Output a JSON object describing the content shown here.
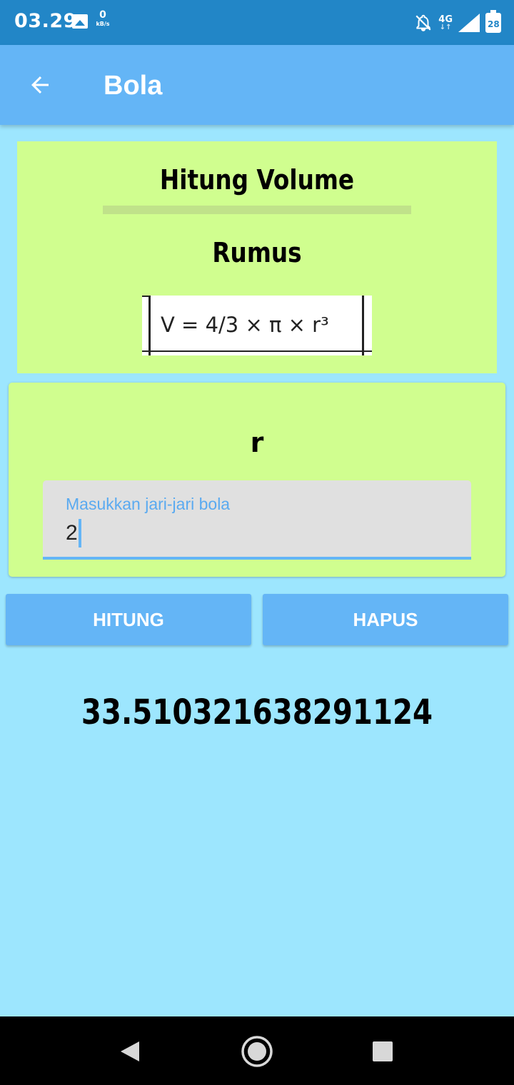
{
  "status_bar": {
    "time": "03.29",
    "speed_value": "0",
    "speed_unit": "kB/s",
    "network": "4G",
    "battery": "28",
    "icons": [
      "image-icon",
      "bell-off-icon",
      "signal-icon",
      "battery-icon"
    ]
  },
  "app_bar": {
    "title": "Bola",
    "back_icon": "arrow-left-icon"
  },
  "formula_card": {
    "heading": "Hitung Volume",
    "subheading": "Rumus",
    "formula": "V = 4/3 × π × r³"
  },
  "input_card": {
    "label": "r",
    "field_label": "Masukkan jari-jari bola",
    "field_value": "2"
  },
  "buttons": {
    "calculate": "HITUNG",
    "clear": "HAPUS"
  },
  "result": "33.510321638291124",
  "colors": {
    "status_bar": "#2286c7",
    "app_bar": "#64b5f6",
    "background": "#9de6fe",
    "card": "#d0fe8f",
    "button": "#64b5f6"
  },
  "nav_bar": {
    "icons": [
      "back-triangle-icon",
      "home-circle-icon",
      "recents-square-icon"
    ]
  }
}
